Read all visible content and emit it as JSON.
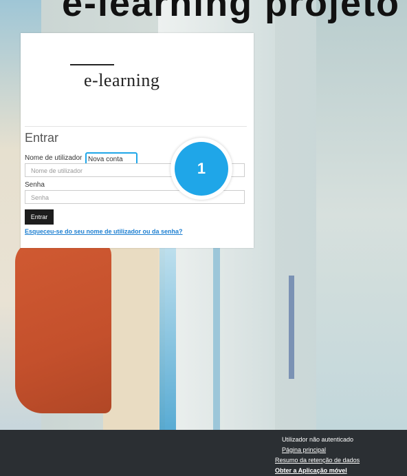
{
  "background": {
    "heading_fragment": "e-learning projeto"
  },
  "login": {
    "logo_text": "e-learning",
    "title": "Entrar",
    "username_label": "Nome de utilizador",
    "new_account_link": "Nova conta",
    "username_placeholder": "Nome de utilizador",
    "password_label": "Senha",
    "password_placeholder": "Senha",
    "submit_label": "Entrar",
    "forgot_link": "Esqueceu-se do seu nome de utilizador ou da senha?"
  },
  "callout": {
    "number": "1",
    "color": "#1fa6e8"
  },
  "footer": {
    "status": "Utilizador não autenticado",
    "home_link": "Página principal",
    "data_retention_link": "Resumo da retenção de dados",
    "mobile_app_link": "Obter a Aplicação móvel"
  }
}
